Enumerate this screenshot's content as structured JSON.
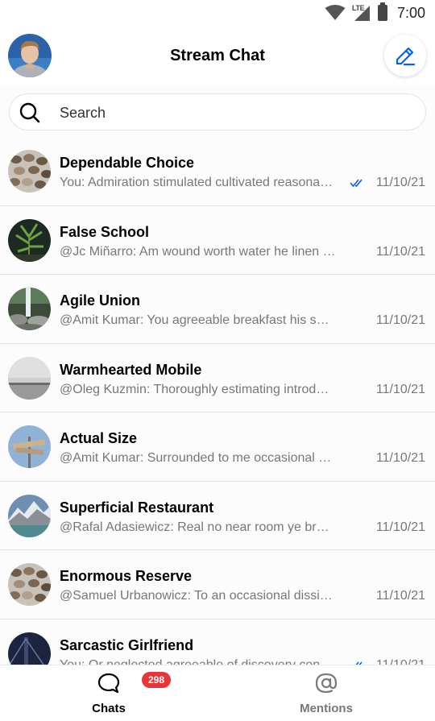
{
  "status_bar": {
    "network": "LTE",
    "time": "7:00"
  },
  "header": {
    "title": "Stream Chat",
    "compose_icon": "pencil-icon",
    "avatar_icon": "user-avatar"
  },
  "search": {
    "placeholder": "Search",
    "value": "",
    "icon": "search-icon"
  },
  "channels": [
    {
      "name": "Dependable Choice",
      "preview": "You: Admiration stimulated cultivated reasonable be projection possession of",
      "date": "11/10/21",
      "read_receipt": true,
      "avatar": "coffee-beans"
    },
    {
      "name": "False School",
      "preview": "@Jc Miñarro: Am wound worth water he linen at vexed",
      "date": "11/10/21",
      "read_receipt": false,
      "avatar": "plant-night"
    },
    {
      "name": "Agile Union",
      "preview": "@Amit Kumar: You agreeable breakfast his set perceived immediate",
      "date": "11/10/21",
      "read_receipt": false,
      "avatar": "waterfall-rocks"
    },
    {
      "name": "Warmhearted Mobile",
      "preview": "@Oleg Kuzmin: Thoroughly estimating introduced stimulated why",
      "date": "11/10/21",
      "read_receipt": false,
      "avatar": "foggy-horizon"
    },
    {
      "name": "Actual Size",
      "preview": "@Amit Kumar: Surrounded to me occasional pianoforte alteration",
      "date": "11/10/21",
      "read_receipt": false,
      "avatar": "signpost-sky"
    },
    {
      "name": "Superficial Restaurant",
      "preview": "@Rafal Adasiewicz: Real no near room ye bred sake if some",
      "date": "11/10/21",
      "read_receipt": false,
      "avatar": "mountain-lake"
    },
    {
      "name": "Enormous Reserve",
      "preview": "@Samuel Urbanowicz: To an occasional dissimilar impossible",
      "date": "11/10/21",
      "read_receipt": false,
      "avatar": "coffee-beans"
    },
    {
      "name": "Sarcastic Girlfriend",
      "preview": "You: Or neglected agreeable of discovery concluded",
      "date": "11/10/21",
      "read_receipt": true,
      "avatar": "night-bridge"
    }
  ],
  "bottom_nav": {
    "chats_label": "Chats",
    "chats_badge": "298",
    "mentions_label": "Mentions",
    "chats_icon": "chat-bubble-icon",
    "mentions_icon": "at-sign-icon"
  },
  "colors": {
    "accent": "#005fff",
    "badge": "#e9353a",
    "caret": "#1a9e8a"
  }
}
